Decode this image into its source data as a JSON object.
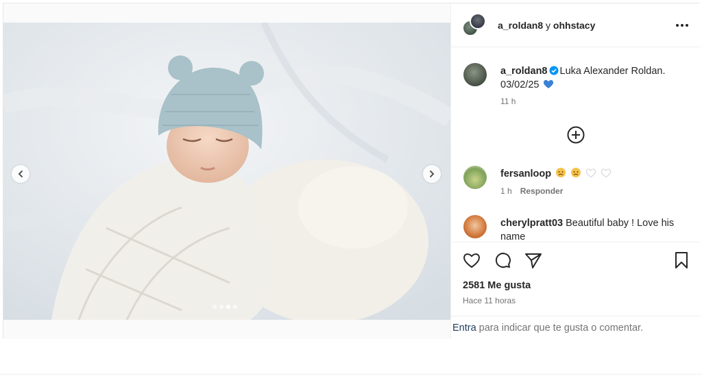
{
  "header": {
    "user_a": "a_roldan8",
    "join": " y ",
    "user_b": "ohhstacy"
  },
  "caption": {
    "username": "a_roldan8",
    "text": "Luka Alexander Roldan. 03/02/25",
    "time": "11 h"
  },
  "comments": [
    {
      "username": "fersanloop",
      "time": "1 h",
      "reply_label": "Responder"
    },
    {
      "username": "cherylpratt03",
      "text": "Beautiful baby ! Love his name"
    }
  ],
  "likes": "2581 Me gusta",
  "posted": "Hace 11 horas",
  "login": {
    "link": "Entra",
    "text": "para indicar que te gusta o comentar."
  },
  "carousel": {
    "slide_count": 4,
    "active_index": 2
  },
  "colors": {
    "verified": "#0095f6",
    "heart_emoji": "#3b82d6",
    "text": "#262626",
    "muted": "#737373"
  },
  "icons": [
    "chevron-left-icon",
    "chevron-right-icon",
    "more-icon",
    "verified-icon",
    "plus-circle-icon",
    "heart-icon",
    "comment-icon",
    "share-icon",
    "bookmark-icon"
  ]
}
